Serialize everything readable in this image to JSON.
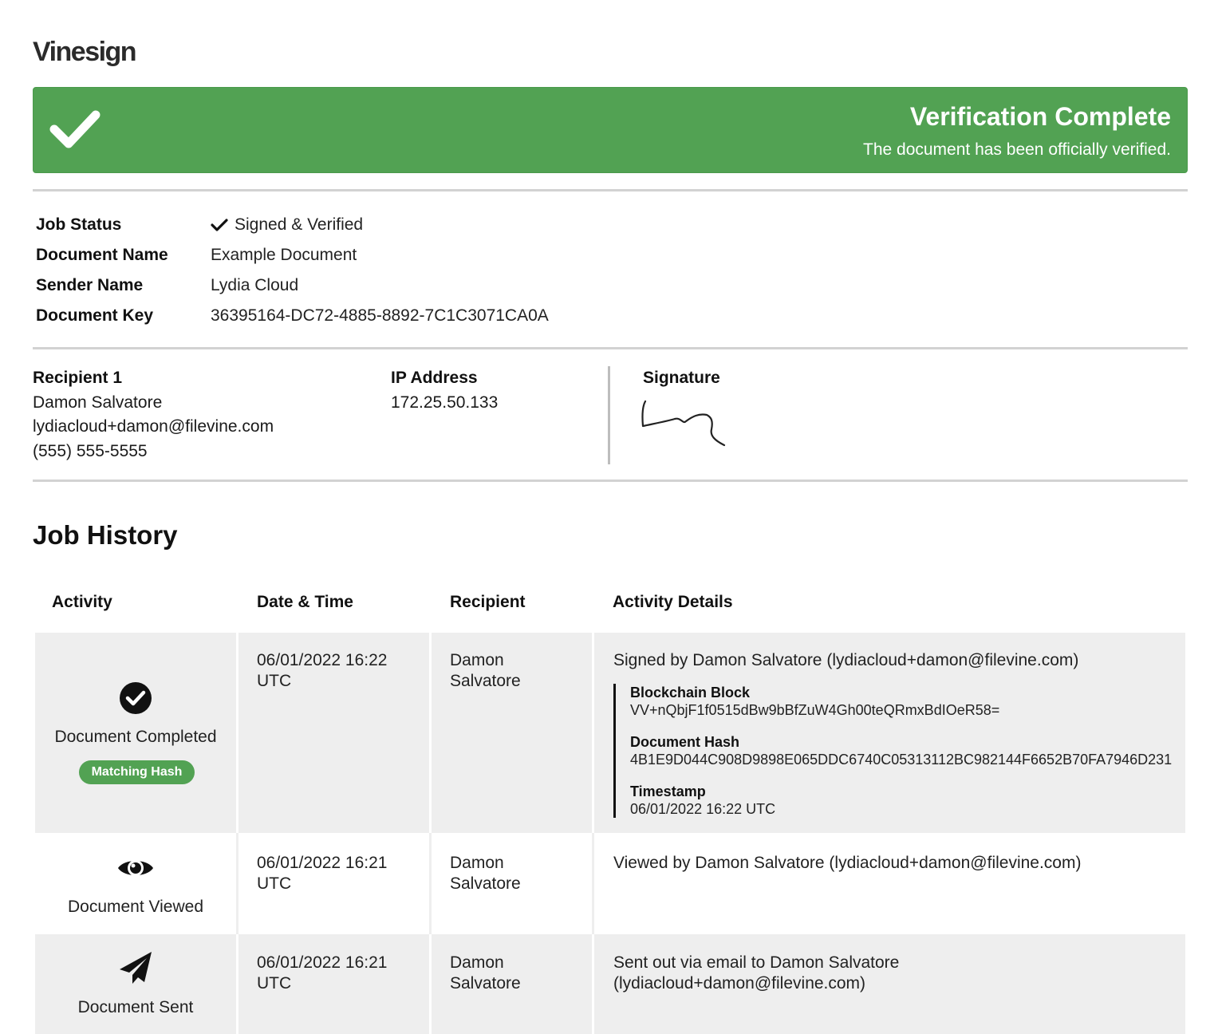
{
  "brand": {
    "logo": "Vinesign"
  },
  "banner": {
    "title": "Verification Complete",
    "subtitle": "The document has been officially verified.",
    "color": "#52a253"
  },
  "job_info": {
    "status_label": "Job Status",
    "status_value": "Signed & Verified",
    "doc_name_label": "Document Name",
    "doc_name_value": "Example Document",
    "sender_label": "Sender Name",
    "sender_value": "Lydia Cloud",
    "doc_key_label": "Document Key",
    "doc_key_value": "36395164-DC72-4885-8892-7C1C3071CA0A"
  },
  "recipient": {
    "label": "Recipient 1",
    "name": "Damon Salvatore",
    "email": "lydiacloud+damon@filevine.com",
    "phone": "(555) 555-5555",
    "ip_label": "IP Address",
    "ip_value": "172.25.50.133",
    "signature_label": "Signature"
  },
  "history": {
    "title": "Job History",
    "columns": [
      "Activity",
      "Date & Time",
      "Recipient",
      "Activity Details"
    ],
    "rows": [
      {
        "icon": "check-circle-icon",
        "activity": "Document Completed",
        "badge": "Matching Hash",
        "date_line1": "06/01/2022 16:22",
        "date_line2": "UTC",
        "recipient_line1": "Damon",
        "recipient_line2": "Salvatore",
        "details": "Signed by Damon Salvatore (lydiacloud+damon@filevine.com)",
        "blockchain_label": "Blockchain Block",
        "blockchain_value": "VV+nQbjF1f0515dBw9bBfZuW4Gh00teQRmxBdIOeR58=",
        "hash_label": "Document Hash",
        "hash_value": "4B1E9D044C908D9898E065DDC6740C05313112BC982144F6652B70FA7946D231",
        "timestamp_label": "Timestamp",
        "timestamp_value": "06/01/2022 16:22 UTC"
      },
      {
        "icon": "eye-icon",
        "activity": "Document Viewed",
        "date_line1": "06/01/2022 16:21",
        "date_line2": "UTC",
        "recipient_line1": "Damon",
        "recipient_line2": "Salvatore",
        "details": "Viewed by Damon Salvatore (lydiacloud+damon@filevine.com)"
      },
      {
        "icon": "paper-plane-icon",
        "activity": "Document Sent",
        "date_line1": "06/01/2022 16:21",
        "date_line2": "UTC",
        "recipient_line1": "Damon",
        "recipient_line2": "Salvatore",
        "details_line1": "Sent out via email to Damon Salvatore",
        "details_line2": "(lydiacloud+damon@filevine.com)"
      }
    ]
  }
}
